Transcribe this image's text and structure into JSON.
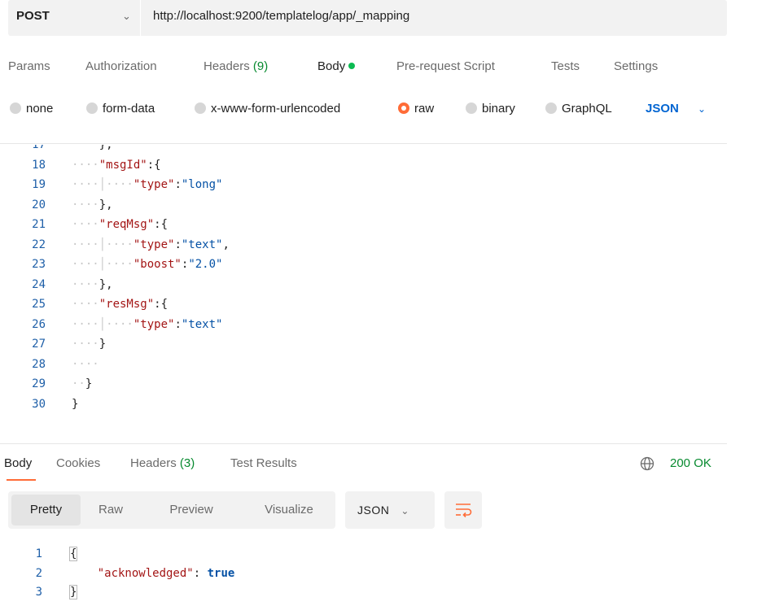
{
  "request": {
    "method": "POST",
    "url": "http://localhost:9200/templatelog/app/_mapping"
  },
  "request_tabs": {
    "params": "Params",
    "authorization": "Authorization",
    "headers": "Headers",
    "headers_count": "(9)",
    "body": "Body",
    "pre_request": "Pre-request Script",
    "tests": "Tests",
    "settings": "Settings"
  },
  "body_types": {
    "none": "none",
    "form_data": "form-data",
    "urlencoded": "x-www-form-urlencoded",
    "raw": "raw",
    "binary": "binary",
    "graphql": "GraphQL",
    "selected": "raw",
    "language": "JSON"
  },
  "editor": {
    "lines": [
      {
        "num": "17",
        "guide": "····",
        "text": "},"
      },
      {
        "num": "18",
        "guide": "····",
        "key": "\"msgId\"",
        "text": ":{"
      },
      {
        "num": "19",
        "guide": "····│····",
        "key": "\"type\"",
        "sep": ":",
        "val": "\"long\""
      },
      {
        "num": "20",
        "guide": "····",
        "text": "},"
      },
      {
        "num": "21",
        "guide": "····",
        "key": "\"reqMsg\"",
        "text": ":{"
      },
      {
        "num": "22",
        "guide": "····│····",
        "key": "\"type\"",
        "sep": ":",
        "val": "\"text\"",
        "tail": ","
      },
      {
        "num": "23",
        "guide": "····│····",
        "key": "\"boost\"",
        "sep": ":",
        "val": "\"2.0\""
      },
      {
        "num": "24",
        "guide": "····",
        "text": "},"
      },
      {
        "num": "25",
        "guide": "····",
        "key": "\"resMsg\"",
        "text": ":{"
      },
      {
        "num": "26",
        "guide": "····│····",
        "key": "\"type\"",
        "sep": ":",
        "val": "\"text\""
      },
      {
        "num": "27",
        "guide": "····",
        "text": "}"
      },
      {
        "num": "28",
        "guide": "····",
        "text": ""
      },
      {
        "num": "29",
        "guide": "··",
        "text": "}"
      },
      {
        "num": "30",
        "guide": "",
        "text": "}"
      }
    ]
  },
  "response_tabs": {
    "body": "Body",
    "cookies": "Cookies",
    "headers": "Headers",
    "headers_count": "(3)",
    "test_results": "Test Results",
    "status": "200 OK"
  },
  "view_tabs": {
    "pretty": "Pretty",
    "raw": "Raw",
    "preview": "Preview",
    "visualize": "Visualize",
    "format": "JSON"
  },
  "response": {
    "lines": [
      {
        "num": "1",
        "text": "{"
      },
      {
        "num": "2",
        "key": "\"acknowledged\"",
        "sep": ": ",
        "val": "true"
      },
      {
        "num": "3",
        "text": "}"
      }
    ]
  },
  "colors": {
    "accent_orange": "#ff6c37",
    "status_green": "#078a2f",
    "link_blue": "#0265d2"
  }
}
